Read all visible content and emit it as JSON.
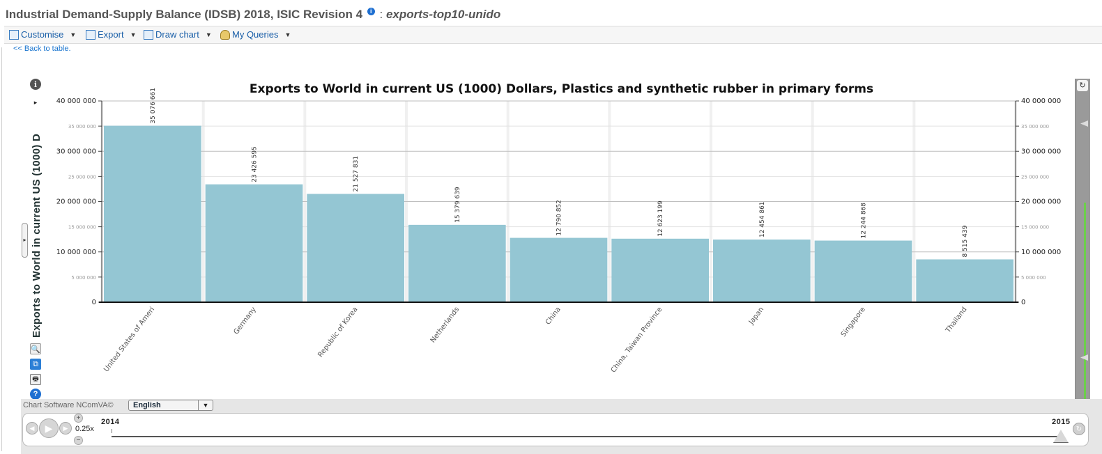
{
  "header": {
    "title": "Industrial Demand-Supply Balance (IDSB) 2018, ISIC Revision 4",
    "info_icon": "i",
    "separator": ":",
    "dataset": "exports-top10-unido"
  },
  "toolbar": {
    "items": [
      {
        "label": "Customise",
        "icon": "table-icon"
      },
      {
        "label": "Export",
        "icon": "export-icon"
      },
      {
        "label": "Draw chart",
        "icon": "chart-icon"
      },
      {
        "label": "My Queries",
        "icon": "user-icon"
      }
    ]
  },
  "back_link": "<< Back to table.",
  "side_tools": {
    "info": "i",
    "play": "▸",
    "zoom": "🔍",
    "crop": "⧉",
    "print": "🖶",
    "help": "?"
  },
  "side_ylabel": "Exports to World in current US (1000) D",
  "chart_data": {
    "type": "bar",
    "title": "Exports to World in current US (1000) Dollars, Plastics and synthetic rubber in primary forms",
    "categories": [
      "United States of Ameri",
      "Germany",
      "Republic of Korea",
      "Netherlands",
      "China",
      "China, Taiwan Province",
      "Japan",
      "Singapore",
      "Thailand"
    ],
    "values": [
      35076661,
      23426595,
      21527831,
      15379639,
      12790852,
      12623199,
      12454861,
      12244868,
      8515439
    ],
    "value_labels": [
      "35 076 661",
      "23 426 595",
      "21 527 831",
      "15 379 639",
      "12 790 852",
      "12 623 199",
      "12 454 861",
      "12 244 868",
      "8 515 439"
    ],
    "ylim": [
      0,
      40000000
    ],
    "major_ticks": [
      {
        "value": 0,
        "label": "0"
      },
      {
        "value": 10000000,
        "label": "10 000 000"
      },
      {
        "value": 20000000,
        "label": "20 000 000"
      },
      {
        "value": 30000000,
        "label": "30 000 000"
      },
      {
        "value": 40000000,
        "label": "40 000 000"
      }
    ],
    "minor_ticks": [
      {
        "value": 5000000,
        "label": "5 000 000"
      },
      {
        "value": 15000000,
        "label": "15 000 000"
      },
      {
        "value": 25000000,
        "label": "25 000 000"
      },
      {
        "value": 35000000,
        "label": "35 000 000"
      }
    ],
    "grid": true,
    "bar_color": "#94c6d3",
    "axis_right": true
  },
  "footer": {
    "credit": "Chart Software NComVA©",
    "language": "English",
    "speed": "0.25x",
    "year_start": "2014",
    "year_end": "2015",
    "plus": "+",
    "minus": "−"
  }
}
